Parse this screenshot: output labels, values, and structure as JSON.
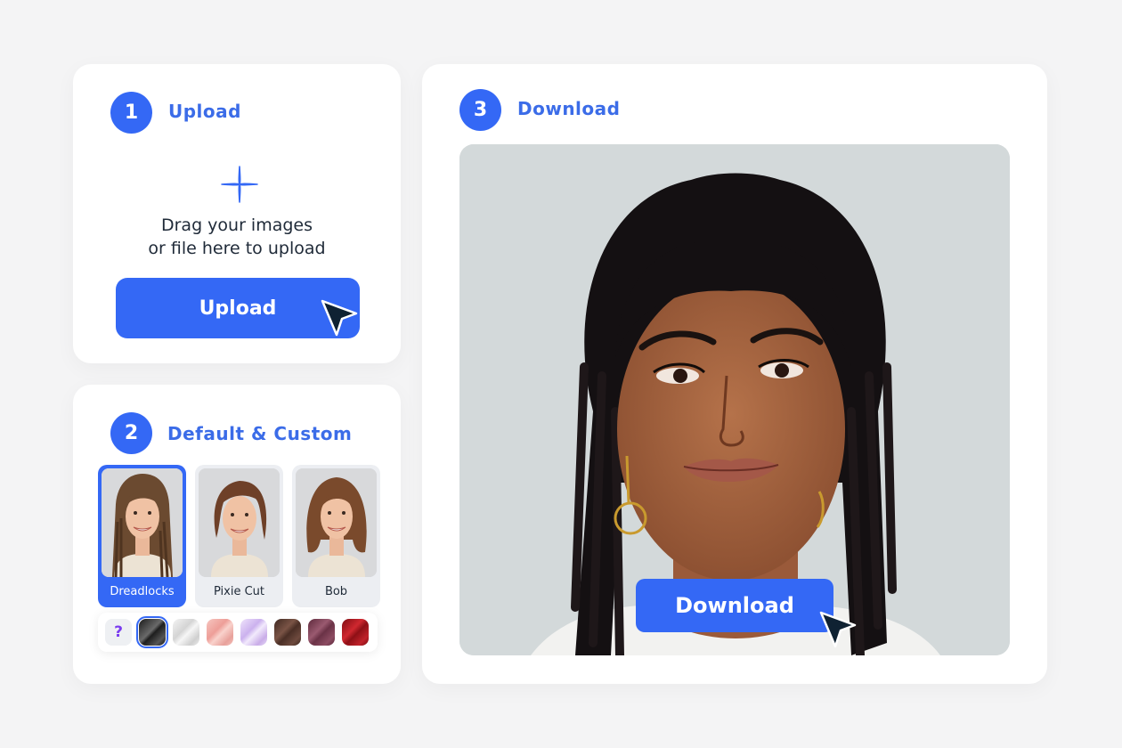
{
  "steps": [
    {
      "number": "1",
      "title": "Upload"
    },
    {
      "number": "2",
      "title": "Default & Custom"
    },
    {
      "number": "3",
      "title": "Download"
    }
  ],
  "upload": {
    "drag_line1": "Drag your images",
    "drag_line2": "or file here to upload",
    "button_label": "Upload",
    "plus_icon": "sparkle-plus-icon"
  },
  "styles": {
    "options": [
      {
        "label": "Dreadlocks",
        "selected": true
      },
      {
        "label": "Pixie Cut",
        "selected": false
      },
      {
        "label": "Bob",
        "selected": false
      }
    ],
    "colors": [
      {
        "name": "random",
        "label": "?"
      },
      {
        "name": "black",
        "hex": "#2a2a2a",
        "selected": true
      },
      {
        "name": "silver",
        "hex": "#e4e4e4"
      },
      {
        "name": "pink",
        "hex": "#f2b3ae"
      },
      {
        "name": "lavender",
        "hex": "#dccaf2"
      },
      {
        "name": "brown",
        "hex": "#5a3a30"
      },
      {
        "name": "mauve",
        "hex": "#7a3e52"
      },
      {
        "name": "red",
        "hex": "#a8141c"
      }
    ]
  },
  "download": {
    "button_label": "Download"
  },
  "colors": {
    "accent": "#3468f5",
    "title": "#3b6ce8",
    "text": "#1f2a38",
    "background": "#f4f4f5"
  }
}
